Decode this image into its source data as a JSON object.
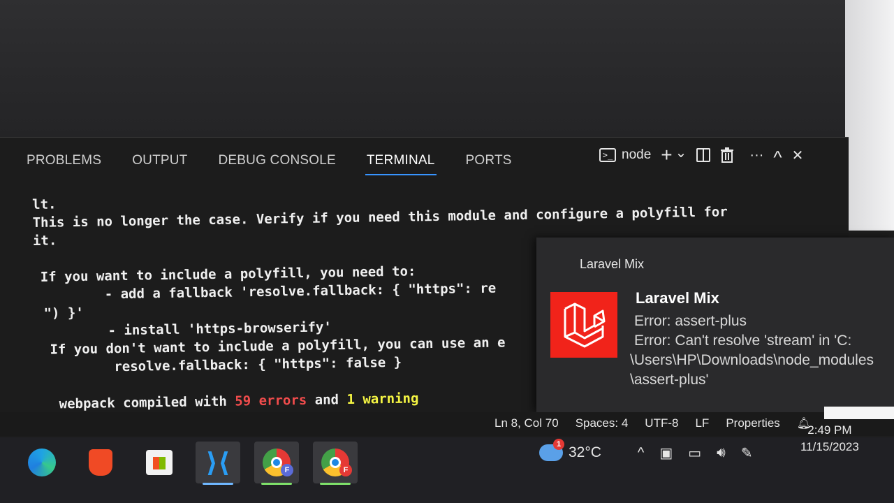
{
  "panel": {
    "tabs": [
      {
        "label": "PROBLEMS"
      },
      {
        "label": "OUTPUT"
      },
      {
        "label": "DEBUG CONSOLE"
      },
      {
        "label": "TERMINAL",
        "active": true
      },
      {
        "label": "PORTS"
      }
    ],
    "actions": {
      "shell_label": "node",
      "add_glyph": "+",
      "chevron_glyph": "⌄",
      "more_glyph": "···",
      "maximize_glyph": "^",
      "close_glyph": "✕"
    }
  },
  "terminal": {
    "lines": [
      "lt.",
      "This is no longer the case. Verify if you need this module and configure a polyfill for",
      "it.",
      "",
      "If you want to include a polyfill, you need to:",
      "        - add a fallback 'resolve.fallback: { \"https\": re",
      "\") }'",
      "        - install 'https-browserify'",
      "If you don't want to include a polyfill, you can use an e",
      "        resolve.fallback: { \"https\": false }",
      ""
    ],
    "summary": {
      "prefix": "webpack compiled with ",
      "errors": "59 errors",
      "middle": " and ",
      "warnings": "1 warning"
    },
    "colors": {
      "error": "#f14c4c",
      "warning": "#f5f543"
    }
  },
  "notification": {
    "app_name": "Laravel Mix",
    "title": "Laravel Mix",
    "body_lines": [
      "Error: assert-plus",
      "Error: Can't resolve 'stream' in 'C:",
      "\\Users\\HP\\Downloads\\node_modules",
      "\\assert-plus'"
    ],
    "logo_icon": "laravel-logo-icon",
    "logo_color": "#f1231a"
  },
  "statusbar": {
    "position": "Ln 8, Col 70",
    "spaces": "Spaces: 4",
    "encoding": "UTF-8",
    "eol": "LF",
    "language": "Properties"
  },
  "taskbar": {
    "apps": [
      {
        "name": "edge",
        "running": false
      },
      {
        "name": "brave",
        "running": false
      },
      {
        "name": "microsoft-store",
        "running": false
      },
      {
        "name": "vscode",
        "running": true
      },
      {
        "name": "chrome-profile-f",
        "running": true,
        "badge": "F"
      },
      {
        "name": "chrome-profile-f-red",
        "running": true,
        "badge": "F"
      }
    ],
    "weather": {
      "temp": "32°C",
      "alerts": "1"
    },
    "clock": {
      "time": "2:49 PM",
      "date": "11/15/2023"
    }
  }
}
